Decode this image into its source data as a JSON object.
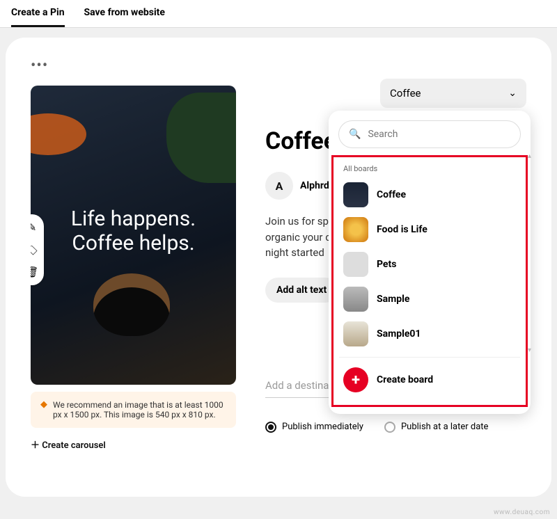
{
  "tabs": {
    "create": "Create a Pin",
    "save": "Save from website"
  },
  "board_select": {
    "selected": "Coffee"
  },
  "search": {
    "placeholder": "Search"
  },
  "dropdown": {
    "section_label": "All boards",
    "boards": [
      {
        "name": "Coffee"
      },
      {
        "name": "Food is Life"
      },
      {
        "name": "Pets"
      },
      {
        "name": "Sample"
      },
      {
        "name": "Sample01"
      }
    ],
    "create_label": "Create board"
  },
  "pin": {
    "title": "Coffee",
    "image_text_line1": "Life happens.",
    "image_text_line2": "Coffee helps.",
    "author_initial": "A",
    "author_name": "Alphrdello",
    "description": "Join us for special morning, organic your day, and cra your night started",
    "alt_button": "Add alt text",
    "recommend": "We recommend an image that is at least 1000 px x 1500 px. This image is 540 px x 810 px.",
    "create_carousel": "Create carousel",
    "dest_placeholder": "Add a destination link"
  },
  "publish": {
    "immediate": "Publish immediately",
    "later": "Publish at a later date"
  },
  "watermark": "www.deuaq.com"
}
